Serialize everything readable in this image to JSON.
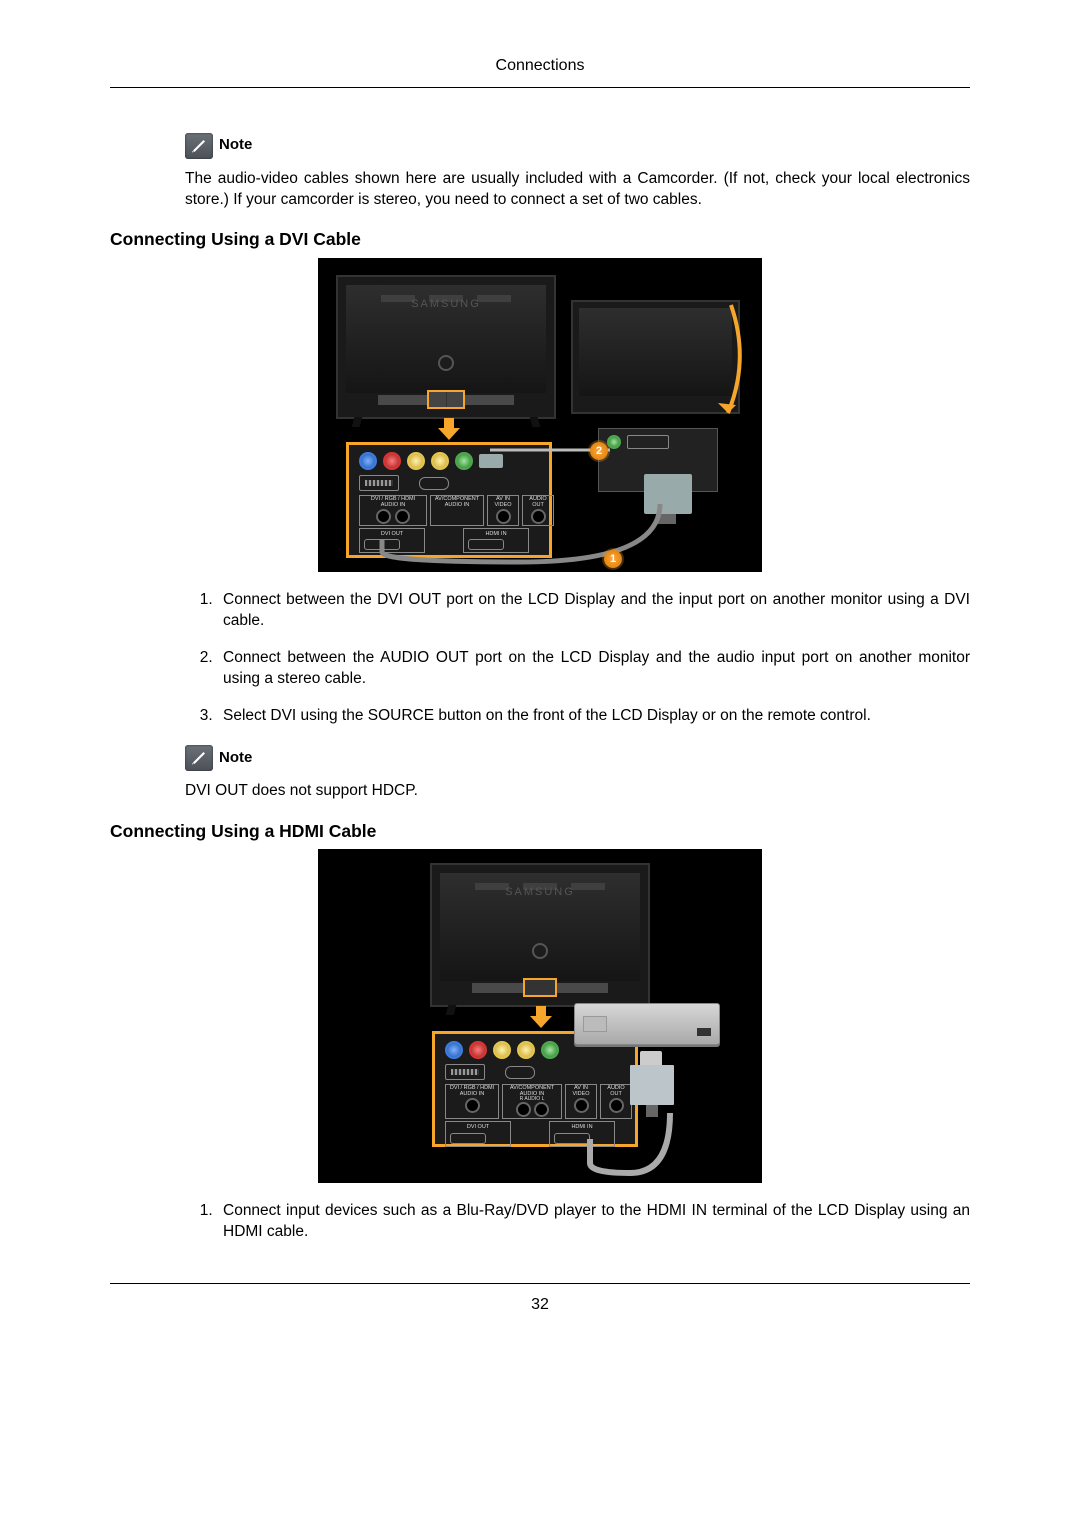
{
  "header": {
    "title": "Connections"
  },
  "topnote": {
    "label": "Note",
    "text": "The audio-video cables shown here are usually included with a Camcorder. (If not, check your local electronics store.) If your camcorder is stereo, you need to connect a set of two cables."
  },
  "section_dvi": {
    "heading": "Connecting Using a DVI Cable",
    "figure": {
      "brand": "SAMSUNG",
      "panel_labels": {
        "row": [
          "DVI / RGB / HDMI AUDIO IN",
          "AV/COMPONENT AUDIO IN",
          "AV IN VIDEO",
          "AUDIO OUT"
        ],
        "out1": "DVI OUT",
        "out2": "HDMI IN"
      },
      "badge1": "1",
      "badge2": "2"
    },
    "steps": [
      "Connect between the DVI OUT port on the LCD Display and the input port on another monitor using a DVI cable.",
      "Connect between the AUDIO OUT port on the LCD Display and the audio input port on another monitor using a stereo cable.",
      "Select DVI using the SOURCE button on the front of the LCD Display or on the remote control."
    ],
    "note": {
      "label": "Note",
      "text": "DVI OUT does not support HDCP."
    }
  },
  "section_hdmi": {
    "heading": "Connecting Using a HDMI Cable",
    "figure": {
      "brand": "SAMSUNG",
      "panel_labels": {
        "row": [
          "DVI / RGB / HDMI AUDIO IN",
          "AV/COMPONENT AUDIO IN",
          "R AUDIO L",
          "AV IN VIDEO",
          "AUDIO OUT"
        ],
        "out1": "DVI OUT",
        "out2": "HDMI IN"
      }
    },
    "steps": [
      "Connect input devices such as a Blu-Ray/DVD player to the HDMI IN terminal of the LCD Display using an HDMI cable."
    ]
  },
  "page_number": "32"
}
